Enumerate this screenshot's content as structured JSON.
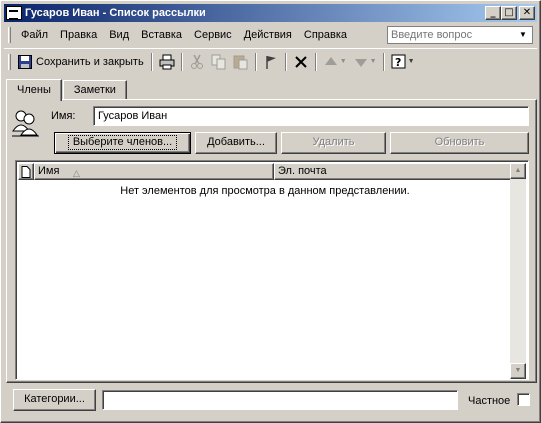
{
  "window": {
    "title": "Гусаров Иван - Список рассылки",
    "minimize": "_",
    "maximize": "□",
    "close": "✕"
  },
  "menu": {
    "items": [
      "Файл",
      "Правка",
      "Вид",
      "Вставка",
      "Сервис",
      "Действия",
      "Справка"
    ],
    "ask_placeholder": "Введите вопрос"
  },
  "toolbar": {
    "save_close_label": "Сохранить и закрыть",
    "icons": [
      "save-icon",
      "print-icon",
      "cut-icon",
      "copy-icon",
      "paste-icon",
      "flag-icon",
      "delete-icon",
      "previous-item-icon",
      "next-item-icon",
      "help-icon"
    ]
  },
  "tabs": [
    {
      "label": "Члены",
      "active": true
    },
    {
      "label": "Заметки",
      "active": false
    }
  ],
  "form": {
    "name_label": "Имя:",
    "name_value": "Гусаров Иван",
    "select_members": "Выберите членов...",
    "add": "Добавить...",
    "remove": "Удалить",
    "update": "Обновить"
  },
  "list": {
    "columns": [
      "Имя",
      "Эл. почта"
    ],
    "empty_message": "Нет элементов для просмотра в данном представлении."
  },
  "bottom": {
    "categories_button": "Категории...",
    "categories_value": "",
    "private_label": "Частное",
    "private_checked": false
  }
}
